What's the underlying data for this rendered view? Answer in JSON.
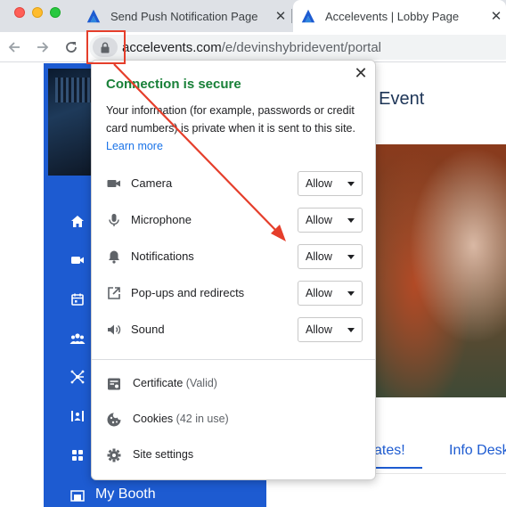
{
  "browser": {
    "tabs": [
      {
        "title": "Send Push Notification Page",
        "favicon": "accelevents-logo-icon",
        "close": "✕",
        "active": false
      },
      {
        "title": "Accelevents | Lobby Page",
        "favicon": "accelevents-logo-icon",
        "close": "✕",
        "active": true
      }
    ],
    "url_host": "accelevents.com",
    "url_path": "/e/devinshybridevent/portal"
  },
  "popup": {
    "title": "Connection is secure",
    "description": "Your information (for example, passwords or credit card numbers) is private when it is sent to this site.",
    "learn_more": "Learn more",
    "close": "✕",
    "permissions": [
      {
        "label": "Camera",
        "value": "Allow",
        "icon": "camera-icon"
      },
      {
        "label": "Microphone",
        "value": "Allow",
        "icon": "microphone-icon"
      },
      {
        "label": "Notifications",
        "value": "Allow",
        "icon": "bell-icon"
      },
      {
        "label": "Pop-ups and redirects",
        "value": "Allow",
        "icon": "external-link-icon"
      },
      {
        "label": "Sound",
        "value": "Allow",
        "icon": "speaker-icon"
      }
    ],
    "links": [
      {
        "label": "Certificate",
        "detail": "(Valid)",
        "icon": "certificate-icon"
      },
      {
        "label": "Cookies",
        "detail": "(42 in use)",
        "icon": "cookie-icon"
      },
      {
        "label": "Site settings",
        "detail": "",
        "icon": "gear-icon"
      }
    ]
  },
  "page": {
    "title_fragment": "al Event",
    "sidebar_label": "My Booth",
    "sidebar_icons": [
      "home-icon",
      "video-icon",
      "calendar-icon",
      "people-icon",
      "network-icon",
      "expo-icon",
      "grid-icon",
      "booth-icon"
    ],
    "tab_a": "ates!",
    "tab_b": "Info Desk"
  },
  "colors": {
    "secure_green": "#188038",
    "link_blue": "#1a73e8",
    "sidebar_blue": "#1d5bd1",
    "annotation_red": "#e53e2b"
  }
}
